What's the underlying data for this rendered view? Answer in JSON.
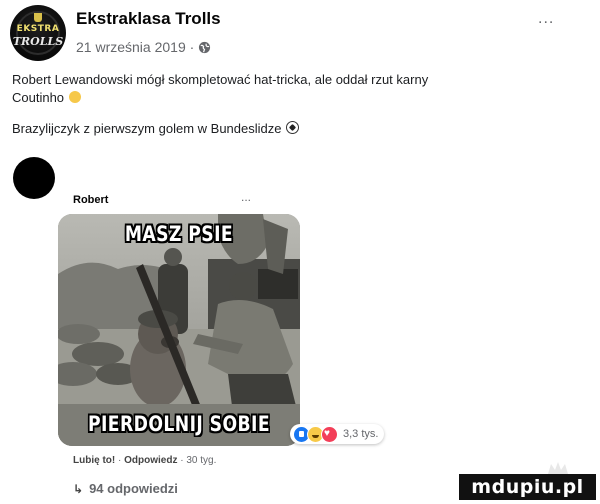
{
  "post": {
    "page_name": "Ekstraklasa Trolls",
    "logo_text_top": "EKSTRA",
    "logo_text_bottom": "TROLLS",
    "date": "21 września 2019 ·",
    "more": "...",
    "text_line_1": "Robert Lewandowski mógł skompletować hat-tricka, ale oddał rzut karny",
    "text_line_2": "Coutinho",
    "text_line_3": "Brazylijczyk z pierwszym golem w Bundeslidze",
    "emoji_1": "face-with-tears-emoji",
    "emoji_2": "soccer-ball-emoji"
  },
  "comment": {
    "author": "Robert",
    "more": "...",
    "meme_top": "MASZ PSIE",
    "meme_bottom": "PIERDOLNIJ SOBIE",
    "reactions": [
      "like",
      "haha",
      "love"
    ],
    "reaction_count": "3,3 tys.",
    "action_like": "Lubię to!",
    "action_reply": "Odpowiedz",
    "action_time": "30 tyg.",
    "replies": "94 odpowiedzi"
  },
  "watermark": "mdupiu.pl",
  "colors": {
    "text": "#1c1e21",
    "meta": "#65676b",
    "like_blue": "#1877f2",
    "love_red": "#f33e58",
    "haha_yellow": "#f7c948"
  }
}
